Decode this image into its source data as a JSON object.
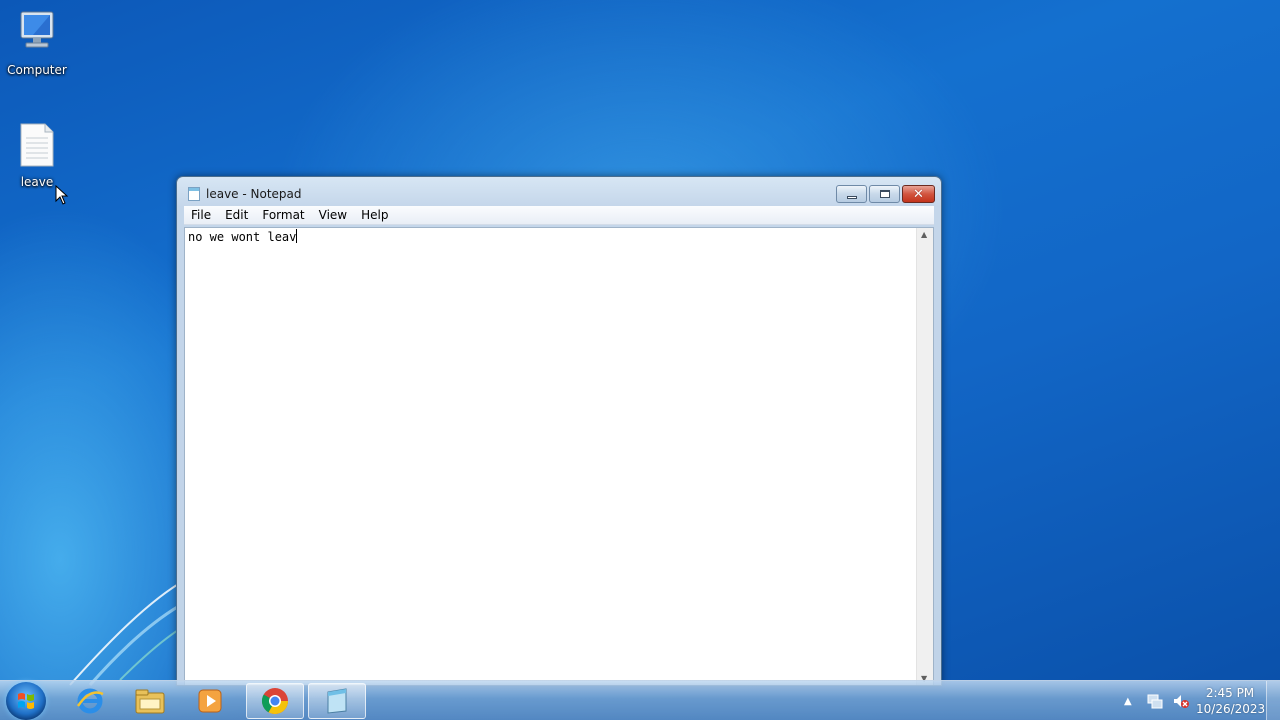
{
  "desktop": {
    "icons": [
      {
        "label": "Computer",
        "icon": "computer-icon"
      },
      {
        "label": "leave",
        "icon": "text-file-icon"
      }
    ]
  },
  "notepad": {
    "title": "leave - Notepad",
    "menu": [
      "File",
      "Edit",
      "Format",
      "View",
      "Help"
    ],
    "content": "no we wont leav"
  },
  "taskbar": {
    "pinned": [
      "start-orb-icon",
      "internet-explorer-icon",
      "file-explorer-icon",
      "media-player-icon",
      "chrome-icon",
      "notepad-icon"
    ],
    "clock": {
      "time": "2:45 PM",
      "date": "10/26/2023"
    }
  },
  "colors": {
    "titlebar": "#c4d6ea",
    "close": "#c3341c",
    "desktop": "#1470cf"
  }
}
